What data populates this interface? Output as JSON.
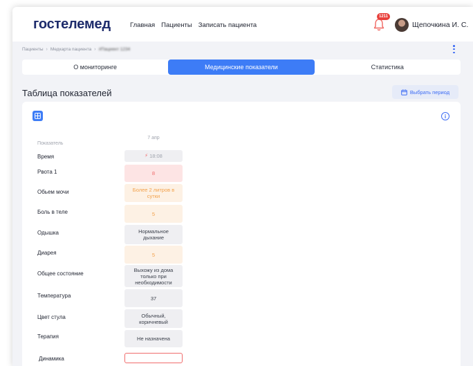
{
  "header": {
    "logo": "гостелемед",
    "nav": [
      "Главная",
      "Пациенты",
      "Записать пациента"
    ],
    "notifications_count": "1211",
    "user_name": "Щепочкина И. С."
  },
  "breadcrumb": [
    "Пациенты",
    "Медкарта пациента",
    "#Пациент 1234"
  ],
  "tabs": [
    {
      "label": "О мониторинге",
      "active": false
    },
    {
      "label": "Медицинские показатели",
      "active": true
    },
    {
      "label": "Статистика",
      "active": false
    }
  ],
  "section_title": "Таблица показателей",
  "period_button": "Выбрать период",
  "table": {
    "header_label": "Показатель",
    "date": "7 апр",
    "rows": [
      {
        "label": "Время",
        "value": "18:08",
        "style": "grey-muted",
        "icon": "lightning-icon"
      },
      {
        "label": "Рвота 1",
        "value": "8",
        "style": "red"
      },
      {
        "label": "Обьем мочи",
        "value": "Более 2 литров в сутки",
        "style": "orange"
      },
      {
        "label": "Боль в теле",
        "value": "5",
        "style": "orange"
      },
      {
        "label": "Одышка",
        "value": "Нормальное дыхание",
        "style": "grey"
      },
      {
        "label": "Диарея",
        "value": "5",
        "style": "orange"
      },
      {
        "label": "Общее состояние",
        "value": "Выхожу из дома только при необходимости",
        "style": "grey"
      },
      {
        "label": "Температура",
        "value": "37",
        "style": "grey"
      },
      {
        "label": "Цвет стула",
        "value": "Обычный, коричневый",
        "style": "grey"
      },
      {
        "label": "Терапия",
        "value": "Не назначена",
        "style": "grey"
      },
      {
        "label": "Динамика",
        "value": "",
        "style": "empty"
      }
    ]
  },
  "colors": {
    "accent": "#3d7cf6",
    "logo": "#1d2b6b",
    "alert_red": "#f06b6b",
    "warning_orange": "#f2a14b"
  }
}
